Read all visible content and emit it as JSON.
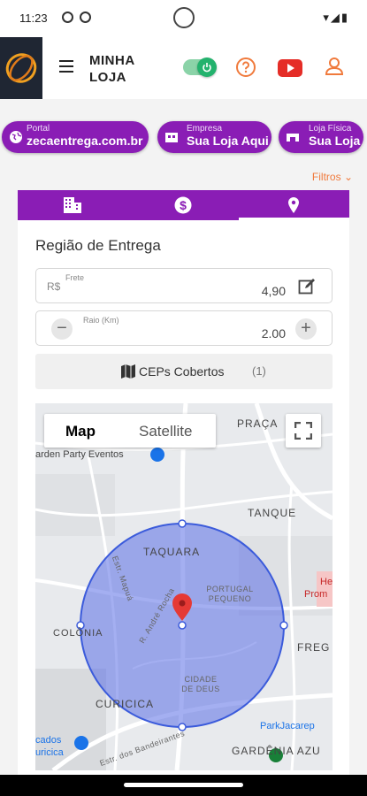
{
  "status_bar": {
    "time": "11:23"
  },
  "header": {
    "brand": "MINHA LOJA"
  },
  "pills": [
    {
      "small": "Portal",
      "big": "zecaentrega.com.br"
    },
    {
      "small": "Empresa",
      "big": "Sua Loja Aqui"
    },
    {
      "small": "Loja Física",
      "big": "Sua Loja"
    }
  ],
  "filters_label": "Filtros",
  "section_title": "Região de Entrega",
  "frete": {
    "label": "Frete",
    "prefix": "R$",
    "value": "4,90"
  },
  "raio": {
    "label": "Raio (Km)",
    "value": "2.00",
    "minus": "−",
    "plus": "+"
  },
  "ceps": {
    "label": "CEPs Cobertos",
    "count": "(1)"
  },
  "map": {
    "type_map": "Map",
    "type_satellite": "Satellite",
    "labels": [
      "PRAÇA",
      "arden Party Eventos",
      "TANQUE",
      "TAQUARA",
      "PORTUGAL PEQUENO",
      "COLÔNIA",
      "FREG",
      "CIDADE DE DEUS",
      "CURICICA",
      "ParkJacarep",
      "GARDÊNIA AZU",
      "cados",
      "uricica",
      "Estr. dos Bandeirantes",
      "Estr. Mapuá",
      "R. André Rocha",
      "He",
      "Prom"
    ]
  },
  "colors": {
    "accent": "#8a1db5",
    "orange": "#f07a3c",
    "red": "#e53935",
    "green": "#23b26d"
  }
}
